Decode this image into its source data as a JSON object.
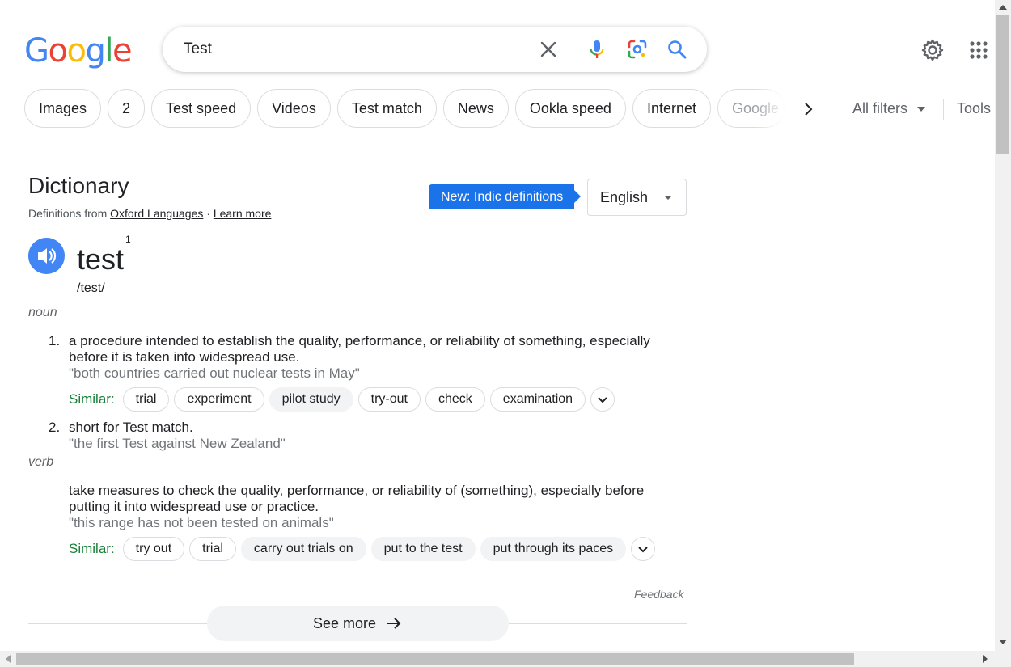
{
  "search": {
    "query": "Test"
  },
  "filters": {
    "chips": [
      "Images",
      "2",
      "Test speed",
      "Videos",
      "Test match",
      "News",
      "Ookla speed",
      "Internet"
    ],
    "faded_chip": "Google s",
    "all_filters": "All filters",
    "tools": "Tools"
  },
  "dictionary": {
    "title": "Dictionary",
    "source_prefix": "Definitions from ",
    "source_link": "Oxford Languages",
    "separator": " · ",
    "learn_more": "Learn more",
    "badge": "New: Indic definitions",
    "language": "English",
    "word": "test",
    "superscript": "1",
    "phonetic": "/test/",
    "noun": {
      "label": "noun",
      "defs": [
        {
          "num": "1.",
          "text": "a procedure intended to establish the quality, performance, or reliability of something, especially before it is taken into widespread use.",
          "example": "\"both countries carried out nuclear tests in May\"",
          "similar": [
            "trial",
            "experiment",
            "pilot study",
            "try-out",
            "check",
            "examination"
          ]
        },
        {
          "num": "2.",
          "prefix": "short for ",
          "link": "Test match",
          "suffix": ".",
          "example": "\"the first Test against New Zealand\""
        }
      ]
    },
    "verb": {
      "label": "verb",
      "text": "take measures to check the quality, performance, or reliability of (something), especially before putting it into widespread use or practice.",
      "example": "\"this range has not been tested on animals\"",
      "similar": [
        "try out",
        "trial",
        "carry out trials on",
        "put to the test",
        "put through its paces"
      ]
    },
    "similar_label": "Similar:",
    "feedback": "Feedback",
    "see_more": "See more"
  }
}
